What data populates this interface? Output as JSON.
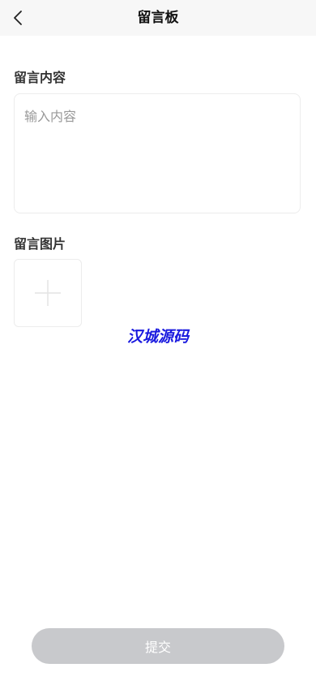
{
  "header": {
    "title": "留言板",
    "back_icon": "chevron-left-icon"
  },
  "message": {
    "label": "留言内容",
    "value": "",
    "placeholder": "输入内容"
  },
  "images": {
    "label": "留言图片",
    "add_icon": "plus-icon"
  },
  "watermark": "汉城源码",
  "submit": {
    "label": "提交",
    "disabled": true
  },
  "colors": {
    "navbar_bg": "#f7f7f7",
    "submit_bg": "#c8c9cc",
    "watermark": "#1a1adf"
  }
}
